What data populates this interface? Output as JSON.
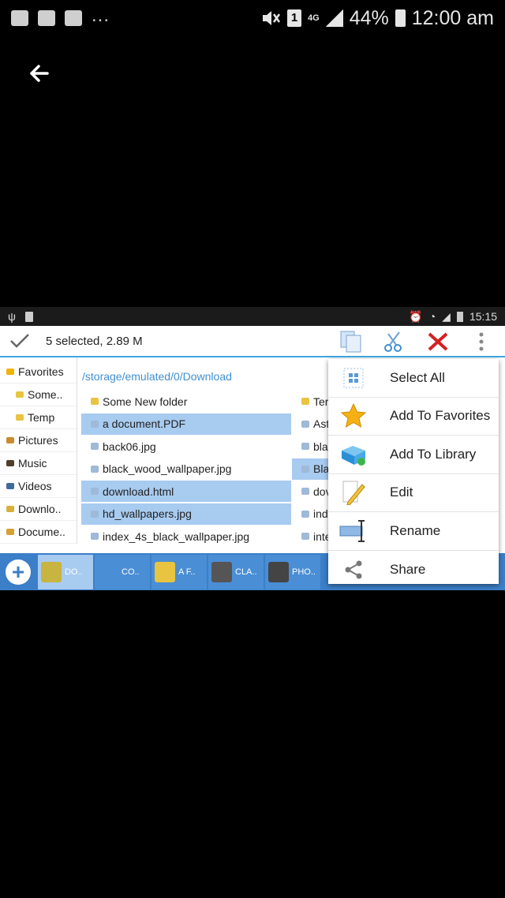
{
  "phone_status": {
    "sim_slot": "1",
    "network": "4G",
    "battery": "44%",
    "time": "12:00 am"
  },
  "inner_status": {
    "time": "15:15"
  },
  "toolbar": {
    "selection": "5 selected, 2.89 M"
  },
  "sidebar": {
    "items": [
      {
        "label": "Favorites",
        "sub": false,
        "color": "#f2b200"
      },
      {
        "label": "Some..",
        "sub": true,
        "color": "#e8c440"
      },
      {
        "label": "Temp",
        "sub": true,
        "color": "#e8c440"
      },
      {
        "label": "Pictures",
        "sub": false,
        "color": "#c98b2e"
      },
      {
        "label": "Music",
        "sub": false,
        "color": "#4f3f2a"
      },
      {
        "label": "Videos",
        "sub": false,
        "color": "#3f6b9b"
      },
      {
        "label": "Downlo..",
        "sub": false,
        "color": "#d7b13a"
      },
      {
        "label": "Docume..",
        "sub": false,
        "color": "#d7a030"
      }
    ]
  },
  "path": "/storage/emulated/0/Download",
  "files_left": [
    {
      "name": "Some New folder",
      "selected": false
    },
    {
      "name": "a document.PDF",
      "selected": true
    },
    {
      "name": "back06.jpg",
      "selected": false
    },
    {
      "name": "black_wood_wallpaper.jpg",
      "selected": false
    },
    {
      "name": "download.html",
      "selected": true
    },
    {
      "name": "hd_wallpapers.jpg",
      "selected": true
    },
    {
      "name": "index_4s_black_wallpaper.jpg",
      "selected": false
    }
  ],
  "files_right": [
    {
      "name": "Ter",
      "selected": false
    },
    {
      "name": "Ast",
      "selected": false
    },
    {
      "name": "bla",
      "selected": false
    },
    {
      "name": "Bla",
      "selected": true
    },
    {
      "name": "dov",
      "selected": false
    },
    {
      "name": "ind",
      "selected": false
    },
    {
      "name": "inte",
      "selected": false
    }
  ],
  "bottom_tabs": [
    {
      "label": "DO..",
      "active": true
    },
    {
      "label": "CO..",
      "active": false
    },
    {
      "label": "A F..",
      "active": false
    },
    {
      "label": "CLA..",
      "active": false
    },
    {
      "label": "PHO..",
      "active": false
    }
  ],
  "menu": {
    "items": [
      {
        "label": "Select All",
        "icon": "select-all-icon"
      },
      {
        "label": "Add To Favorites",
        "icon": "star-icon"
      },
      {
        "label": "Add To Library",
        "icon": "library-icon"
      },
      {
        "label": "Edit",
        "icon": "pencil-icon"
      },
      {
        "label": "Rename",
        "icon": "rename-icon"
      },
      {
        "label": "Share",
        "icon": "share-icon"
      }
    ]
  }
}
